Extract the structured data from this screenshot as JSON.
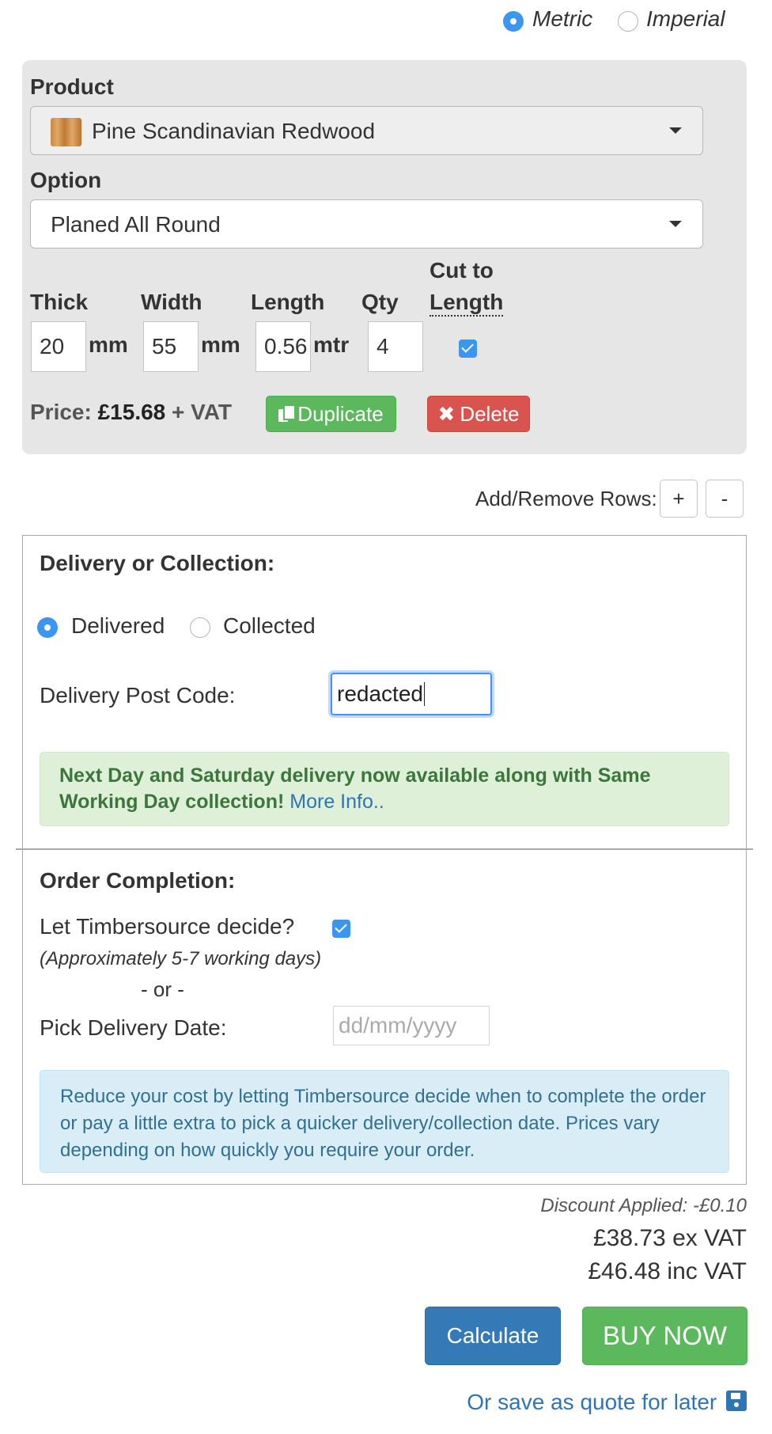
{
  "units": {
    "options": [
      {
        "label": "Metric",
        "selected": true
      },
      {
        "label": "Imperial",
        "selected": false
      }
    ]
  },
  "product_row": {
    "product_label": "Product",
    "product_value": "Pine Scandinavian Redwood",
    "option_label": "Option",
    "option_value": "Planed All Round",
    "thick_label": "Thick",
    "width_label": "Width",
    "length_label": "Length",
    "qty_label": "Qty",
    "cut_label_line1": "Cut to",
    "cut_label_line2": "Length",
    "thick_value": "20",
    "thick_unit": "mm",
    "width_value": "55",
    "width_unit": "mm",
    "length_value": "0.56",
    "length_unit": "mtr",
    "qty_value": "4",
    "cut_to_length_checked": true,
    "price_label": "Price:",
    "price_value": "£15.68",
    "price_suffix": "+ VAT",
    "duplicate_label": "Duplicate",
    "delete_label": "Delete"
  },
  "rows_control": {
    "label": "Add/Remove Rows:",
    "add_label": "+",
    "remove_label": "-"
  },
  "delivery": {
    "heading": "Delivery or Collection:",
    "options": [
      {
        "label": "Delivered",
        "selected": true
      },
      {
        "label": "Collected",
        "selected": false
      }
    ],
    "postcode_label": "Delivery Post Code:",
    "postcode_value": "redacted",
    "notice_bold": "Next Day and Saturday delivery now available along with Same Working Day collection!",
    "notice_link": "More Info.."
  },
  "completion": {
    "heading": "Order Completion:",
    "decide_label": "Let Timbersource decide?",
    "decide_checked": true,
    "decide_note": "(Approximately 5-7 working days)",
    "or_text": "- or -",
    "pick_label": "Pick Delivery Date:",
    "date_placeholder": "dd/mm/yyyy",
    "info": "Reduce your cost by letting Timbersource decide when to complete the order or pay a little extra to pick a quicker delivery/collection date. Prices vary depending on how quickly you require your order."
  },
  "totals": {
    "discount": "Discount Applied: -£0.10",
    "ex_vat": "£38.73 ex VAT",
    "inc_vat": "£46.48 inc VAT"
  },
  "actions": {
    "calculate_label": "Calculate",
    "buy_label": "BUY NOW",
    "save_quote_label": "Or save as quote for later"
  },
  "colors": {
    "accent_blue": "#3b96f0",
    "success_green": "#5cb85c",
    "danger_red": "#d9534f",
    "primary_blue": "#337ab7",
    "link_blue": "#2f74b5"
  },
  "icons": {
    "duplicate": "copy-icon",
    "delete": "times-icon",
    "save": "floppy-disk-icon",
    "swatch": "wood-swatch-icon",
    "dropdown": "caret-down-icon"
  }
}
